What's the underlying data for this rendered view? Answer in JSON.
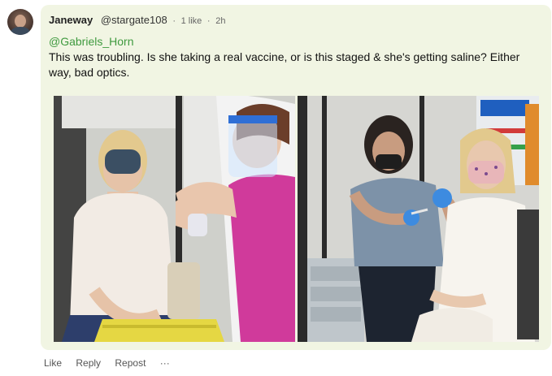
{
  "post": {
    "author": "Janeway",
    "handle": "@stargate108",
    "likes": "1 like",
    "separator": "·",
    "time": "2h",
    "mention": "@Gabriels_Horn",
    "body": "This was troubling. Is she taking a real vaccine, or is this staged & she's getting saline? Either way, bad optics."
  },
  "actions": {
    "like": "Like",
    "reply": "Reply",
    "repost": "Repost",
    "more": "···"
  },
  "colors": {
    "card_bg": "#f1f5e3",
    "mention": "#3f9a3f",
    "face_shield_blue": "#2f6fd6",
    "scrubs_magenta": "#d03a9b",
    "gloves_blue": "#3d8be0"
  },
  "icons": {
    "avatar": "user-avatar",
    "more": "more-icon"
  }
}
